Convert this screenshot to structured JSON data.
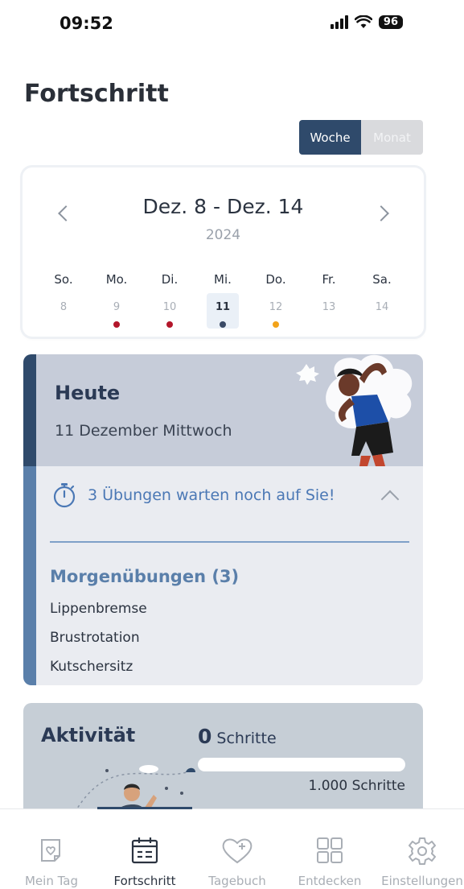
{
  "status": {
    "time": "09:52",
    "battery": "96"
  },
  "page_title": "Fortschritt",
  "toggle": {
    "week": "Woche",
    "month": "Monat",
    "selected": "Woche"
  },
  "week": {
    "range": "Dez. 8 - Dez. 14",
    "year": "2024",
    "days": [
      {
        "name": "So.",
        "date": "8",
        "dot": ""
      },
      {
        "name": "Mo.",
        "date": "9",
        "dot": "#b3162a"
      },
      {
        "name": "Di.",
        "date": "10",
        "dot": "#b3162a"
      },
      {
        "name": "Mi.",
        "date": "11",
        "dot": "#3a4a66",
        "selected": true
      },
      {
        "name": "Do.",
        "date": "12",
        "dot": "#f2a31a"
      },
      {
        "name": "Fr.",
        "date": "13",
        "dot": ""
      },
      {
        "name": "Sa.",
        "date": "14",
        "dot": ""
      }
    ]
  },
  "today": {
    "title": "Heute",
    "date": "11 Dezember Mittwoch",
    "pending": "3 Übungen warten noch auf Sie!",
    "group_title": "Morgenübungen (3)",
    "exercises": [
      "Lippenbremse",
      "Brustrotation",
      "Kutschersitz"
    ]
  },
  "activity": {
    "title": "Aktivität",
    "steps_value": "0",
    "steps_unit": "Schritte",
    "goal": "1.000 Schritte",
    "progress": 0
  },
  "tabs": [
    {
      "label": "Mein Tag",
      "icon": "calendar-heart-icon"
    },
    {
      "label": "Fortschritt",
      "icon": "calendar-icon",
      "active": true
    },
    {
      "label": "Tagebuch",
      "icon": "heart-plus-icon"
    },
    {
      "label": "Entdecken",
      "icon": "grid-icon"
    },
    {
      "label": "Einstellungen",
      "icon": "gear-icon"
    }
  ],
  "colors": {
    "accent": "#2f4a6b",
    "link": "#4b78b5"
  }
}
